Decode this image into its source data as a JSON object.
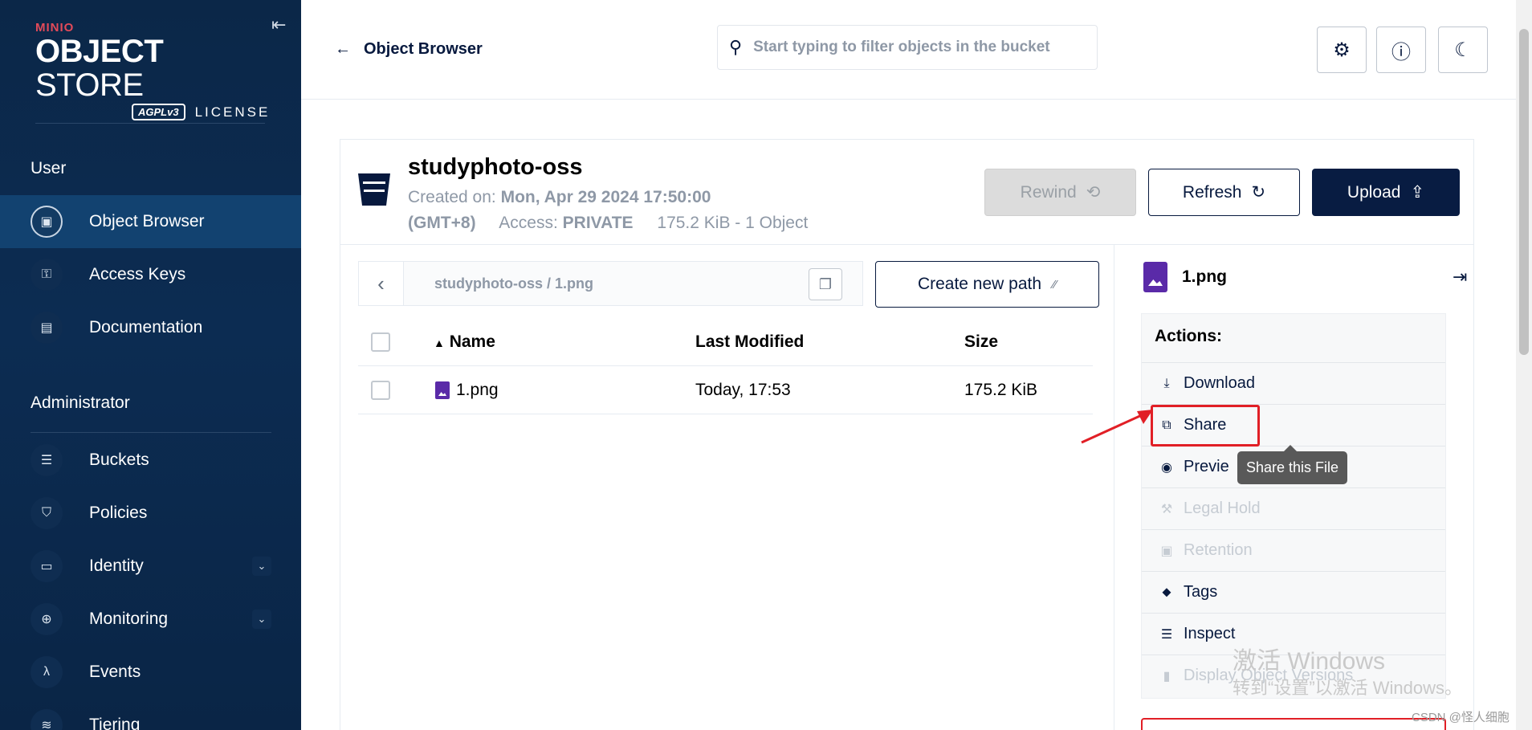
{
  "sidebar": {
    "logo": {
      "brand": "MINIO",
      "title_bold": "OBJECT",
      "title_rest": " STORE",
      "badge": "AGPLv3",
      "license": "LICENSE"
    },
    "sections": [
      {
        "title": "User"
      },
      {
        "title": "Administrator"
      }
    ],
    "user_items": [
      {
        "label": "Object Browser",
        "icon": "object-browser-icon",
        "active": true
      },
      {
        "label": "Access Keys",
        "icon": "access-keys-icon"
      },
      {
        "label": "Documentation",
        "icon": "documentation-icon"
      }
    ],
    "admin_items": [
      {
        "label": "Buckets",
        "icon": "buckets-icon"
      },
      {
        "label": "Policies",
        "icon": "policies-icon"
      },
      {
        "label": "Identity",
        "icon": "identity-icon",
        "expandable": true
      },
      {
        "label": "Monitoring",
        "icon": "monitoring-icon",
        "expandable": true
      },
      {
        "label": "Events",
        "icon": "lambda-icon"
      },
      {
        "label": "Tiering",
        "icon": "tiering-icon"
      }
    ]
  },
  "topbar": {
    "back_label": "Object Browser",
    "search_placeholder": "Start typing to filter objects in the bucket"
  },
  "bucket": {
    "name": "studyphoto-oss",
    "created_label": "Created on: ",
    "created_value": "Mon, Apr 29 2024 17:50:00",
    "timezone": "(GMT+8)",
    "access_label": "Access: ",
    "access_value": "PRIVATE",
    "usage": "175.2 KiB - 1 Object",
    "buttons": {
      "rewind": "Rewind",
      "refresh": "Refresh",
      "upload": "Upload"
    }
  },
  "browser": {
    "breadcrumb": "studyphoto-oss  /  1.png",
    "create_path": "Create new path",
    "columns": {
      "name": "Name",
      "modified": "Last Modified",
      "size": "Size"
    },
    "rows": [
      {
        "name": "1.png",
        "modified": "Today, 17:53",
        "size": "175.2 KiB"
      }
    ]
  },
  "details": {
    "file_name": "1.png",
    "actions_title": "Actions:",
    "actions": [
      {
        "label": "Download",
        "icon": "download-icon",
        "disabled": false
      },
      {
        "label": "Share",
        "icon": "share-icon",
        "disabled": false
      },
      {
        "label": "Previe",
        "icon": "eye-icon",
        "disabled": false
      },
      {
        "label": "Legal Hold",
        "icon": "gavel-icon",
        "disabled": true
      },
      {
        "label": "Retention",
        "icon": "retention-icon",
        "disabled": true
      },
      {
        "label": "Tags",
        "icon": "tag-icon",
        "disabled": false
      },
      {
        "label": "Inspect",
        "icon": "inspect-icon",
        "disabled": false
      },
      {
        "label": "Display Object Versions",
        "icon": "versions-icon",
        "disabled": true
      }
    ],
    "tooltip": "Share this File"
  },
  "watermark": {
    "line1": "激活 Windows",
    "line2": "转到“设置”以激活 Windows。",
    "credit": "CSDN @怪人细胞"
  },
  "colors": {
    "sidebar": "#0b2748",
    "accent": "#081c42",
    "highlight": "#e11f26",
    "file_icon": "#5a2aa8"
  }
}
